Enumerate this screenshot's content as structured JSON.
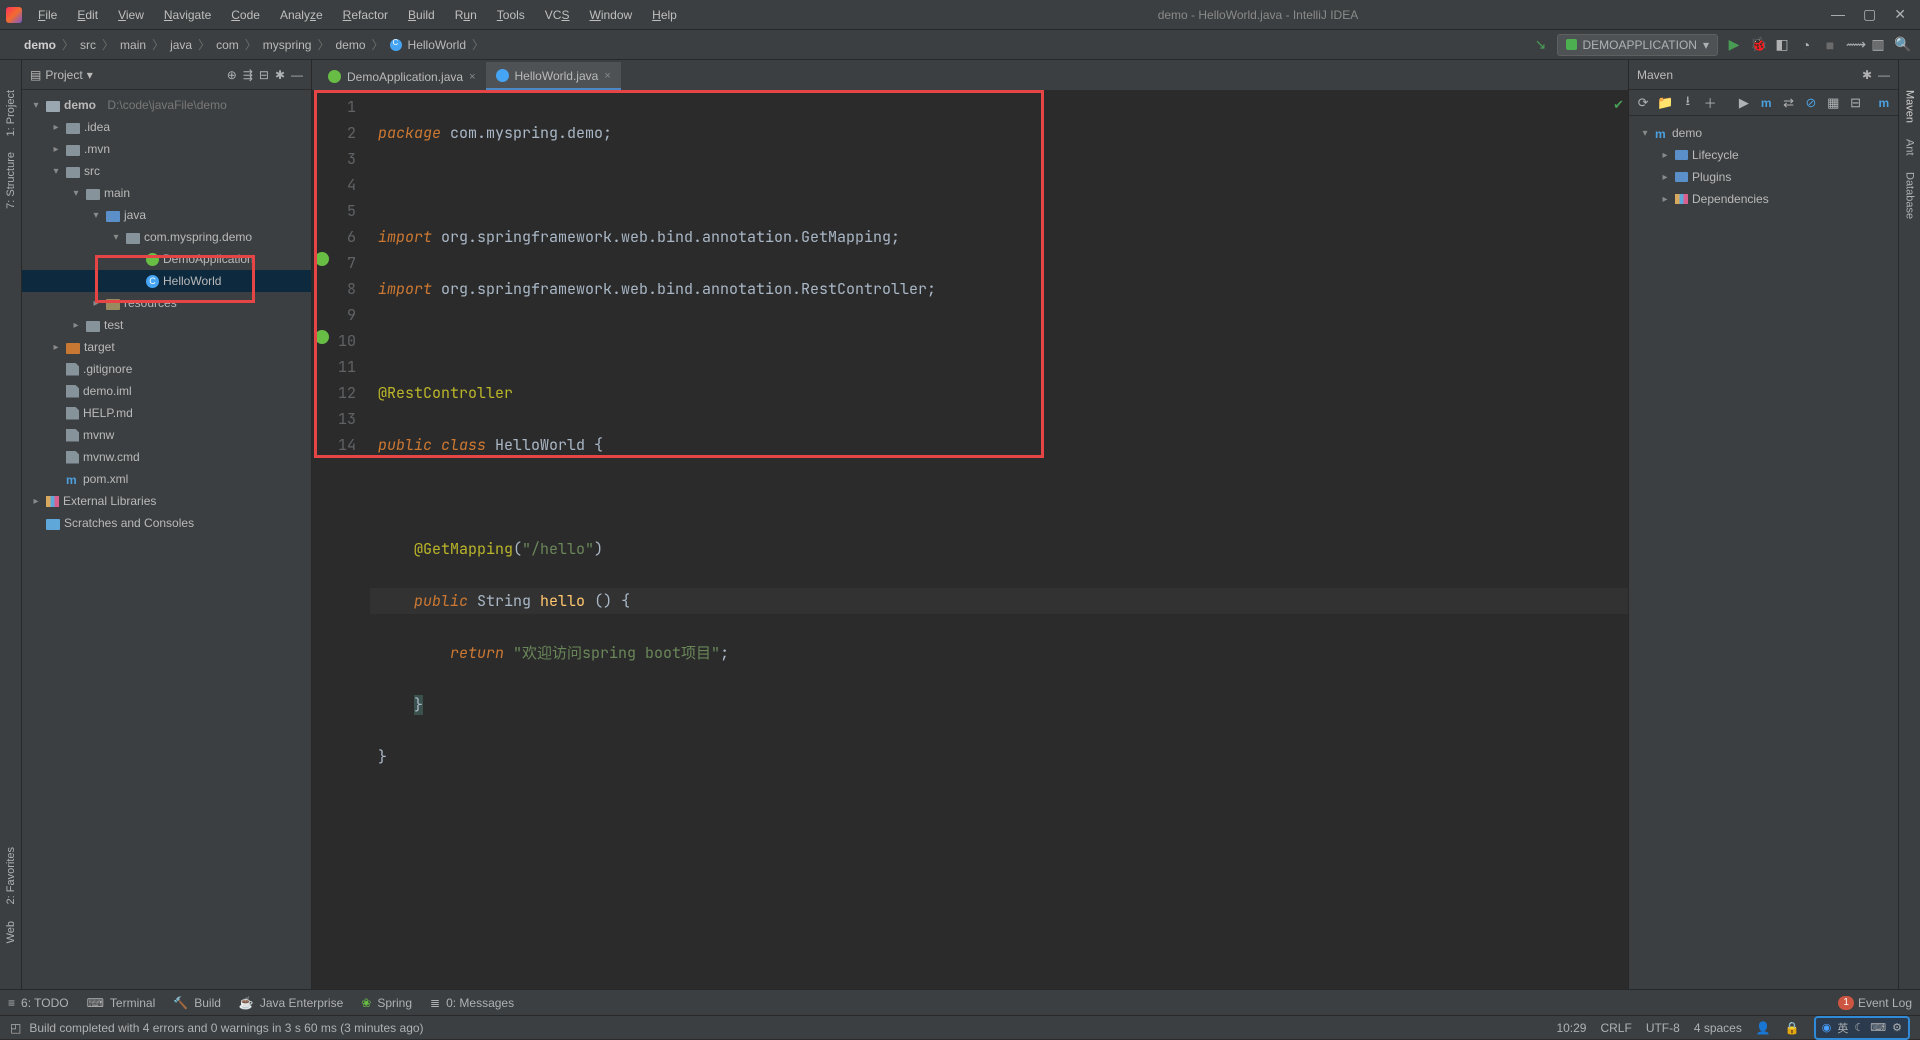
{
  "window": {
    "title": "demo - HelloWorld.java - IntelliJ IDEA",
    "menus": [
      "File",
      "Edit",
      "View",
      "Navigate",
      "Code",
      "Analyze",
      "Refactor",
      "Build",
      "Run",
      "Tools",
      "VCS",
      "Window",
      "Help"
    ]
  },
  "breadcrumb": [
    "demo",
    "src",
    "main",
    "java",
    "com",
    "myspring",
    "demo",
    "HelloWorld"
  ],
  "run_config": "DEMOAPPLICATION",
  "project_panel": {
    "title": "Project",
    "root_name": "demo",
    "root_path": "D:\\code\\javaFile\\demo",
    "tree": {
      "idea": ".idea",
      "mvn": ".mvn",
      "src": "src",
      "main": "main",
      "java_folder": "java",
      "package": "com.myspring.demo",
      "demo_application": "DemoApplication",
      "hello_world": "HelloWorld",
      "resources": "resources",
      "test": "test",
      "target": "target",
      "gitignore": ".gitignore",
      "demo_iml": "demo.iml",
      "help_md": "HELP.md",
      "mvnw": "mvnw",
      "mvnw_cmd": "mvnw.cmd",
      "pom_xml": "pom.xml",
      "external_libs": "External Libraries",
      "scratches": "Scratches and Consoles"
    }
  },
  "tabs": {
    "tab1": "DemoApplication.java",
    "tab2": "HelloWorld.java"
  },
  "code": {
    "l1_kw": "package",
    "l1_pkg": " com.myspring.demo",
    "l1_p": ";",
    "l3_kw": "import",
    "l3_pkg": " org.springframework.web.bind.annotation.GetMapping",
    "l3_p": ";",
    "l4_kw": "import",
    "l4_pkg": " org.springframework.web.bind.annotation.RestController",
    "l4_p": ";",
    "l6_ann": "@RestController",
    "l7_kw1": "public",
    "l7_kw2": " class",
    "l7_cls": " HelloWorld",
    "l7_p": " {",
    "l9_ann": "@GetMapping",
    "l9_p1": "(",
    "l9_str": "\"/hello\"",
    "l9_p2": ")",
    "l10_kw": "public",
    "l10_type": " String",
    "l10_mtd": " hello",
    "l10_p": " () {",
    "l11_kw": "return",
    "l11_sp": " ",
    "l11_str": "\"欢迎访问spring boot项目\"",
    "l11_p": ";",
    "l12": "}",
    "l13": "}"
  },
  "line_numbers": [
    "1",
    "2",
    "3",
    "4",
    "5",
    "6",
    "7",
    "8",
    "9",
    "10",
    "11",
    "12",
    "13",
    "14"
  ],
  "maven": {
    "title": "Maven",
    "root": "demo",
    "lifecycle": "Lifecycle",
    "plugins": "Plugins",
    "dependencies": "Dependencies"
  },
  "left_tools": {
    "project": "1: Project",
    "structure": "7: Structure",
    "favorites": "2: Favorites",
    "web": "Web"
  },
  "right_tools": {
    "maven": "Maven",
    "ant": "Ant",
    "database": "Database"
  },
  "bottom_tools": {
    "todo": "6: TODO",
    "terminal": "Terminal",
    "build": "Build",
    "java_enterprise": "Java Enterprise",
    "spring": "Spring",
    "messages": "0: Messages",
    "event_log": "Event Log",
    "event_count": "1"
  },
  "status": {
    "message": "Build completed with 4 errors and 0 warnings in 3 s 60 ms (3 minutes ago)",
    "pos": "10:29",
    "line_sep": "CRLF",
    "encoding": "UTF-8",
    "indent": "4 spaces",
    "ime": "英"
  }
}
